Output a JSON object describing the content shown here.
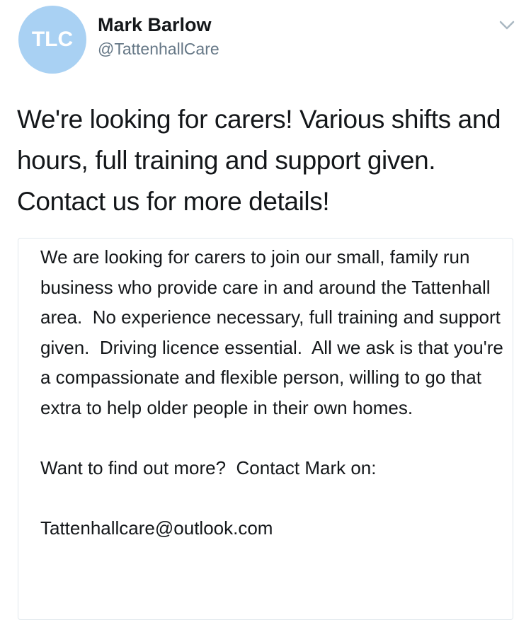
{
  "tweet": {
    "avatar_text": "TLC",
    "display_name": "Mark Barlow",
    "handle": "@TattenhallCare",
    "text": "We're looking for carers! Various shifts and hours, full training and support given. Contact us for more details!",
    "card": {
      "paragraph_1": "We are looking for carers to join our small, family run business who provide care in and around the Tattenhall area.  No experience necessary, full training and support given.  Driving licence essential.  All we ask is that you're a compassionate and flexible person, willing to go that extra to help older people in their own homes.",
      "paragraph_2": "Want to find out more?  Contact Mark on:",
      "email": "Tattenhallcare@outlook.com"
    }
  },
  "icons": {
    "menu": "chevron-down-icon"
  },
  "colors": {
    "avatar_bg": "#a9d1f3",
    "handle": "#657786",
    "text": "#14171a",
    "card_border": "#e1e8ed"
  }
}
